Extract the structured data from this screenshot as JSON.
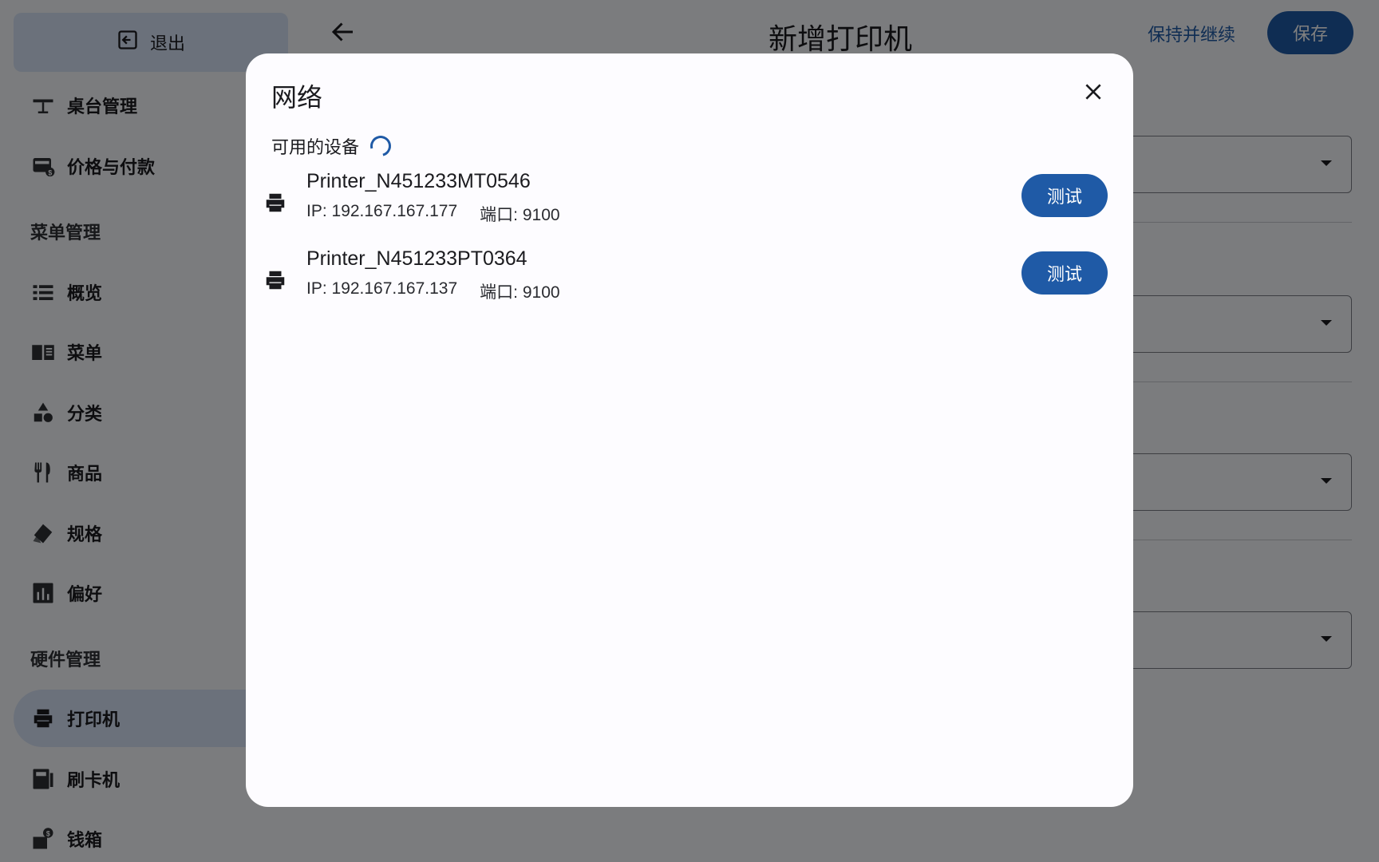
{
  "sidebar": {
    "exit_label": "退出",
    "items": [
      {
        "label": "桌台管理",
        "icon": "table-icon"
      },
      {
        "label": "价格与付款",
        "icon": "wallet-icon"
      },
      {
        "label": "概览",
        "icon": "list-icon"
      },
      {
        "label": "菜单",
        "icon": "book-icon"
      },
      {
        "label": "分类",
        "icon": "category-icon"
      },
      {
        "label": "商品",
        "icon": "utensils-icon"
      },
      {
        "label": "规格",
        "icon": "tag-icon"
      },
      {
        "label": "偏好",
        "icon": "chart-icon"
      },
      {
        "label": "打印机",
        "icon": "printer-icon",
        "active": true
      },
      {
        "label": "刷卡机",
        "icon": "card-reader-icon"
      },
      {
        "label": "钱箱",
        "icon": "cash-drawer-icon"
      }
    ],
    "sections": {
      "menu_management": "菜单管理",
      "hardware_management": "硬件管理"
    }
  },
  "header": {
    "title": "新增打印机",
    "keep_continue": "保持并继续",
    "save": "保存"
  },
  "dialog": {
    "title": "网络",
    "available_label": "可用的设备",
    "devices": [
      {
        "name": "Printer_N451233MT0546",
        "ip": "IP: 192.167.167.177",
        "port": "端口: 9100",
        "button": "测试"
      },
      {
        "name": "Printer_N451233PT0364",
        "ip": "IP: 192.167.167.137",
        "port": "端口: 9100",
        "button": "测试"
      }
    ]
  },
  "colors": {
    "accent": "#1f5aa6",
    "sidebar_active": "#d7e3f6"
  }
}
